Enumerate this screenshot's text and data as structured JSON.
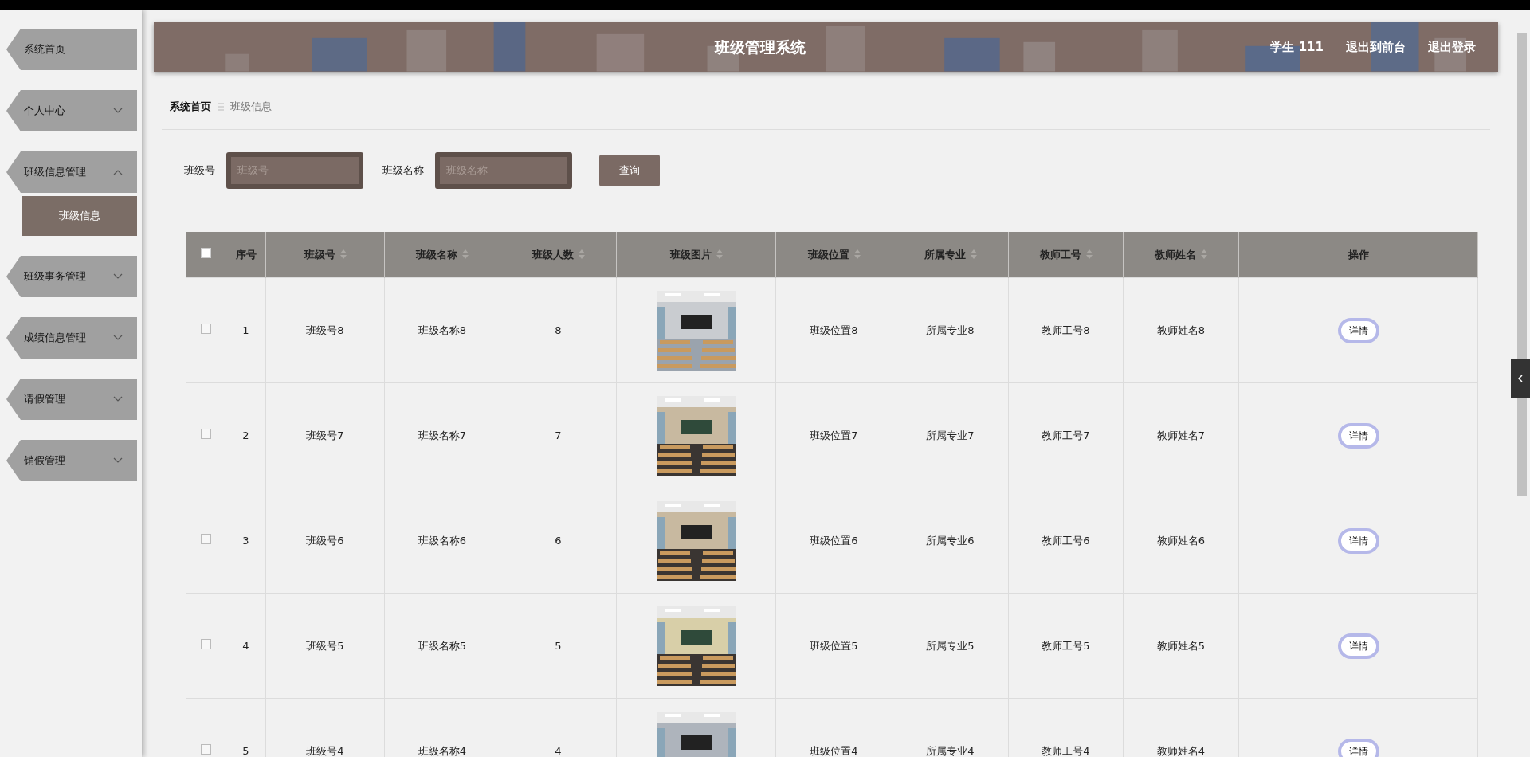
{
  "sidebar": {
    "items": [
      {
        "kind": "link",
        "label": "系统首页"
      },
      {
        "kind": "group",
        "label": "个人中心",
        "expanded": false
      },
      {
        "kind": "group",
        "label": "班级信息管理",
        "expanded": true,
        "children": [
          {
            "label": "班级信息",
            "selected": true
          }
        ]
      },
      {
        "kind": "group",
        "label": "班级事务管理",
        "expanded": false
      },
      {
        "kind": "group",
        "label": "成绩信息管理",
        "expanded": false
      },
      {
        "kind": "group",
        "label": "请假管理",
        "expanded": false
      },
      {
        "kind": "group",
        "label": "销假管理",
        "expanded": false
      }
    ]
  },
  "header": {
    "title": "班级管理系统",
    "user": "学生 111",
    "links": [
      "退出到前台",
      "退出登录"
    ]
  },
  "breadcrumb": [
    "系统首页",
    "班级信息"
  ],
  "search": {
    "fields": [
      {
        "label": "班级号",
        "placeholder": "班级号"
      },
      {
        "label": "班级名称",
        "placeholder": "班级名称"
      }
    ],
    "button": "查询"
  },
  "table": {
    "select_all": {
      "checked": false
    },
    "columns": [
      {
        "label": "序号",
        "sortable": false
      },
      {
        "label": "班级号",
        "sortable": true
      },
      {
        "label": "班级名称",
        "sortable": true
      },
      {
        "label": "班级人数",
        "sortable": true
      },
      {
        "label": "班级图片",
        "sortable": true
      },
      {
        "label": "班级位置",
        "sortable": true
      },
      {
        "label": "所属专业",
        "sortable": true
      },
      {
        "label": "教师工号",
        "sortable": true
      },
      {
        "label": "教师姓名",
        "sortable": true
      },
      {
        "label": "操作",
        "sortable": false
      }
    ],
    "rows": [
      {
        "checked": false,
        "cells": [
          "1",
          "班级号8",
          "班级名称8",
          "8",
          {
            "kind": "picture"
          },
          "班级位置8",
          "所属专业8",
          "教师工号8",
          "教师姓名8"
        ],
        "action": "详情"
      },
      {
        "checked": false,
        "cells": [
          "2",
          "班级号7",
          "班级名称7",
          "7",
          {
            "kind": "picture"
          },
          "班级位置7",
          "所属专业7",
          "教师工号7",
          "教师姓名7"
        ],
        "action": "详情"
      },
      {
        "checked": false,
        "cells": [
          "3",
          "班级号6",
          "班级名称6",
          "6",
          {
            "kind": "picture"
          },
          "班级位置6",
          "所属专业6",
          "教师工号6",
          "教师姓名6"
        ],
        "action": "详情"
      },
      {
        "checked": false,
        "cells": [
          "4",
          "班级号5",
          "班级名称5",
          "5",
          {
            "kind": "picture"
          },
          "班级位置5",
          "所属专业5",
          "教师工号5",
          "教师姓名5"
        ],
        "action": "详情"
      },
      {
        "checked": false,
        "cells": [
          "5",
          "班级号4",
          "班级名称4",
          "4",
          {
            "kind": "picture"
          },
          "班级位置4",
          "所属专业4",
          "教师工号4",
          "教师姓名4"
        ],
        "action": "详情"
      }
    ]
  }
}
